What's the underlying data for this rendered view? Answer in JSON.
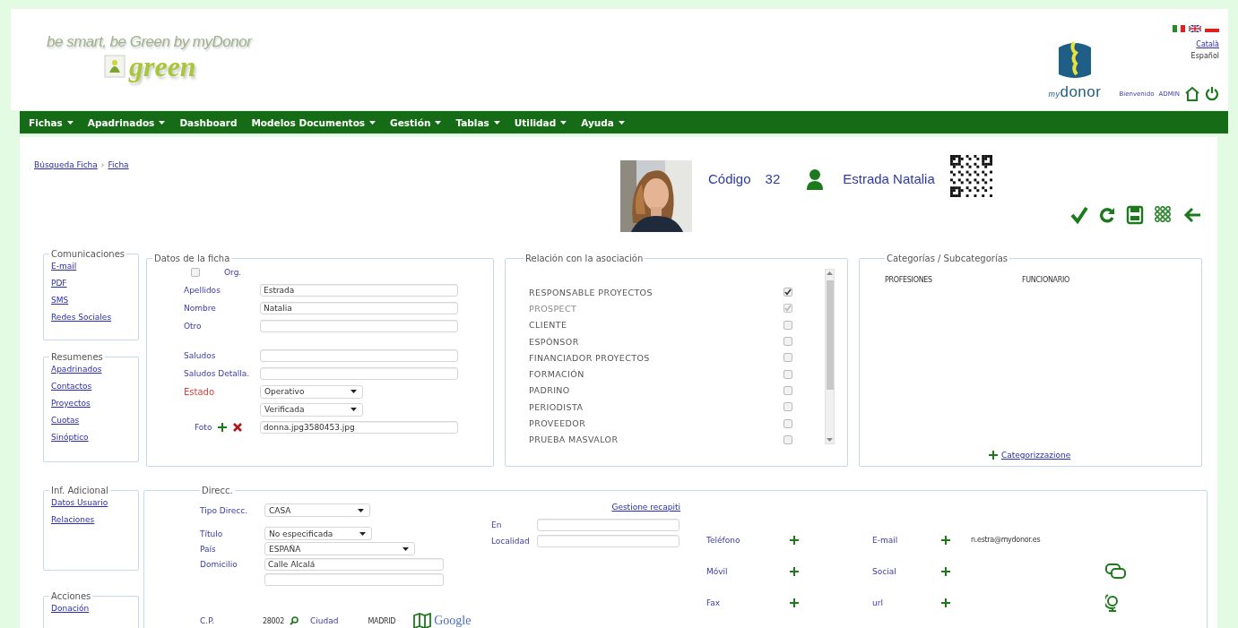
{
  "header": {
    "tagline": "be smart, be Green by myDonor",
    "logo_word": "green",
    "brand_prefix": "my",
    "brand": "donor",
    "languages": [
      {
        "label": "Català",
        "selected": false
      },
      {
        "label": "Español",
        "selected": true
      }
    ],
    "welcome": "Bienvenido",
    "user": "ADMIN"
  },
  "menu": [
    {
      "label": "Fichas",
      "dropdown": true
    },
    {
      "label": "Apadrinados",
      "dropdown": true
    },
    {
      "label": "Dashboard",
      "dropdown": false
    },
    {
      "label": "Modelos Documentos",
      "dropdown": true
    },
    {
      "label": "Gestión",
      "dropdown": true
    },
    {
      "label": "Tablas",
      "dropdown": true
    },
    {
      "label": "Utilidad",
      "dropdown": true
    },
    {
      "label": "Ayuda",
      "dropdown": true
    }
  ],
  "breadcrumb": {
    "items": [
      "Búsqueda Ficha",
      "Ficha"
    ],
    "separator": "›"
  },
  "record": {
    "code_label": "Código",
    "code": "32",
    "name": "Estrada Natalia"
  },
  "side_top": [
    {
      "title": "Comunicaciones",
      "links": [
        "E-mail",
        "PDF",
        "SMS",
        "Redes Sociales"
      ]
    },
    {
      "title": "Resumenes",
      "links": [
        "Apadrinados",
        "Contactos",
        "Proyectos",
        "Cuotas",
        "Sinóptico"
      ]
    }
  ],
  "datos": {
    "title": "Datos de la ficha",
    "org": {
      "label": "Org.",
      "checked": false
    },
    "field_groups": [
      [
        {
          "kind": "text",
          "label": "Apellidos",
          "value": "Estrada",
          "alert": false
        },
        {
          "kind": "text",
          "label": "Nombre",
          "value": "Natalia",
          "alert": false
        },
        {
          "kind": "text",
          "label": "Otro",
          "alert": false
        }
      ],
      [
        {
          "kind": "text",
          "label": "Saludos",
          "alert": false
        },
        {
          "kind": "text",
          "label": "Saludos Detalla.",
          "alert": false
        },
        {
          "kind": "select",
          "label": "Estado",
          "value": "Operativo",
          "alert": true
        },
        {
          "kind": "select",
          "value": "Verificada"
        },
        {
          "label": "Foto",
          "value": "donna.jpg3580453.jpg",
          "alert": false
        }
      ]
    ]
  },
  "relacion": {
    "title": "Relación con la asociación",
    "items": [
      {
        "label": "RESPONSABLE PROYECTOS",
        "checked": true,
        "disabled": false
      },
      {
        "label": "PROSPECT",
        "checked": true,
        "disabled": true
      },
      {
        "label": "CLIENTE",
        "checked": false,
        "disabled": false
      },
      {
        "label": "ESPÓNSOR",
        "checked": false,
        "disabled": false
      },
      {
        "label": "FINANCIADOR PROYECTOS",
        "checked": false,
        "disabled": false
      },
      {
        "label": "FORMACIÓN",
        "checked": false,
        "disabled": false
      },
      {
        "label": "PADRINO",
        "checked": false,
        "disabled": false
      },
      {
        "label": "PERIODISTA",
        "checked": false,
        "disabled": false
      },
      {
        "label": "PROVEEDOR",
        "checked": false,
        "disabled": false
      },
      {
        "label": "PRUEBA MASVALOR",
        "checked": false,
        "disabled": false
      }
    ]
  },
  "categorias": {
    "title": "Categorías / Subcategorías",
    "rows": [
      {
        "category": "PROFESIONES",
        "subcategory": "FUNCIONARIO"
      }
    ],
    "add_link": "Categorizzazione"
  },
  "side_bottom": [
    {
      "title": "Inf. Adicional",
      "links": [
        "Datos Usuario",
        "Relaciones"
      ]
    },
    {
      "title": "Acciones",
      "links": [
        "Donación"
      ]
    }
  ],
  "direccion": {
    "title": "Direcc.",
    "type_field": {
      "kind": "select",
      "label": "Tipo Direcc.",
      "value": "CASA"
    },
    "fields": [
      {
        "kind": "select",
        "label": "Título",
        "value": "No especificada"
      },
      {
        "kind": "select",
        "label": "País",
        "value": "ESPAÑA"
      },
      {
        "kind": "text",
        "label": "Domicilio",
        "value": "Calle Alcalá"
      },
      {
        "kind": "text"
      }
    ],
    "manage_link": "Gestione recapiti",
    "locality_fields": [
      {
        "label": "En"
      },
      {
        "label": "Localidad"
      }
    ],
    "postal": {
      "cp_label": "C.P.",
      "cp": "28002",
      "city_label": "Ciudad",
      "city": "MADRID",
      "map_label": "Google"
    },
    "contacts": [
      {
        "label": "Teléfono"
      },
      {
        "label": "E-mail",
        "value": "n.estra@mydonor.es"
      },
      {
        "label": "Móvil"
      },
      {
        "label": "Social"
      },
      {
        "label": "Fax"
      },
      {
        "label": "url"
      }
    ]
  }
}
